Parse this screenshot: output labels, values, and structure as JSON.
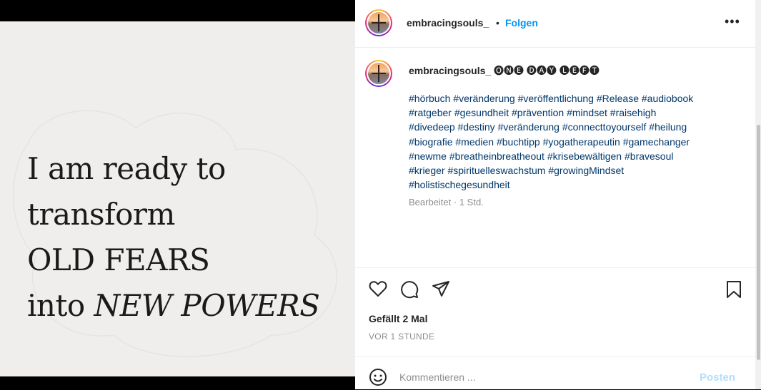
{
  "post": {
    "image_text": {
      "line1": "I am ready to",
      "line2": "transform",
      "line3": "OLD FEARS",
      "line4_plain": "into ",
      "line4_italic": "NEW POWERS"
    }
  },
  "header": {
    "username": "embracingsouls_",
    "separator": "•",
    "follow_label": "Folgen",
    "more_label": "•••"
  },
  "caption": {
    "username": "embracingsouls_",
    "text": "🅞🅝🅔 🅓🅐🅨 🅛🅔🅕🅣",
    "hashtags": [
      "#hörbuch",
      "#veränderung",
      "#veröffentlichung",
      "#Release",
      "#audiobook",
      "#ratgeber",
      "#gesundheit",
      "#prävention",
      "#mindset",
      "#raisehigh",
      "#divedeep",
      "#destiny",
      "#veränderung",
      "#connecttoyourself",
      "#heilung",
      "#biografie",
      "#medien",
      "#buchtipp",
      "#yogatherapeutin",
      "#gamechanger",
      "#newme",
      "#breatheinbreatheout",
      "#krisebewältigen",
      "#bravesoul",
      "#krieger",
      "#spirituelleswachstum",
      "#growingMindset",
      "#holistischegesundheit"
    ],
    "meta": "Bearbeitet · 1 Std."
  },
  "actions": {
    "icons": [
      "heart-icon",
      "comment-icon",
      "share-icon",
      "bookmark-icon"
    ]
  },
  "likes": "Gefällt 2 Mal",
  "time_ago": "VOR 1 STUNDE",
  "comment": {
    "placeholder": "Kommentieren ...",
    "value": "",
    "post_label": "Posten"
  },
  "colors": {
    "link": "#0095f6",
    "hashtag": "#00376b",
    "muted": "#8e8e8e",
    "post_disabled": "#b2dffc",
    "image_background": "#efeeec"
  }
}
